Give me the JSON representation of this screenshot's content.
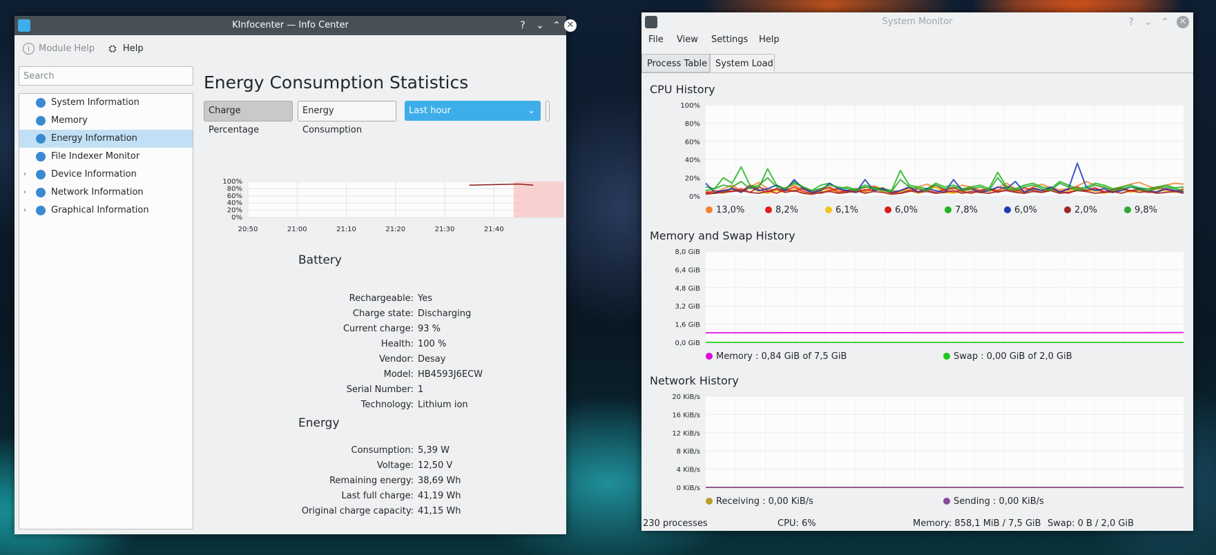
{
  "kinfo": {
    "window_title": "KInfocenter — Info Center",
    "toolbar": {
      "module_help": "Module Help",
      "help": "Help"
    },
    "search_placeholder": "Search",
    "tree": [
      {
        "label": "System Information",
        "expandable": false,
        "selected": false
      },
      {
        "label": "Memory",
        "expandable": false,
        "selected": false
      },
      {
        "label": "Energy Information",
        "expandable": false,
        "selected": true
      },
      {
        "label": "File Indexer Monitor",
        "expandable": false,
        "selected": false
      },
      {
        "label": "Device Information",
        "expandable": true,
        "selected": false
      },
      {
        "label": "Network Information",
        "expandable": true,
        "selected": false
      },
      {
        "label": "Graphical Information",
        "expandable": true,
        "selected": false
      }
    ],
    "title": "Energy Consumption Statistics",
    "buttons": {
      "charge": "Charge Percentage",
      "energy": "Energy Consumption"
    },
    "range_select": "Last hour",
    "chart_data": {
      "type": "line",
      "y_ticks": [
        "100%",
        "80%",
        "60%",
        "40%",
        "20%",
        "0%"
      ],
      "x_ticks": [
        "20:50",
        "21:00",
        "21:10",
        "21:20",
        "21:30",
        "21:40"
      ],
      "ylim": [
        0,
        100
      ],
      "series": [
        {
          "x": [
            "21:35",
            "21:45",
            "21:48"
          ],
          "values": [
            90,
            93,
            90
          ]
        }
      ],
      "colors": {
        "line": "#8b1a1a",
        "highlight": "#f9c6c6"
      }
    },
    "battery": {
      "heading": "Battery",
      "rows": [
        {
          "k": "Rechargeable:",
          "v": "Yes"
        },
        {
          "k": "Charge state:",
          "v": "Discharging"
        },
        {
          "k": "Current charge:",
          "v": "93 %"
        },
        {
          "k": "Health:",
          "v": "100 %"
        },
        {
          "k": "Vendor:",
          "v": "Desay"
        },
        {
          "k": "Model:",
          "v": "HB4593J6ECW"
        },
        {
          "k": "Serial Number:",
          "v": "1"
        },
        {
          "k": "Technology:",
          "v": "Lithium ion"
        }
      ]
    },
    "energy": {
      "heading": "Energy",
      "rows": [
        {
          "k": "Consumption:",
          "v": "5,39 W"
        },
        {
          "k": "Voltage:",
          "v": "12,50 V"
        },
        {
          "k": "Remaining energy:",
          "v": "38,69 Wh"
        },
        {
          "k": "Last full charge:",
          "v": "41,19 Wh"
        },
        {
          "k": "Original charge capacity:",
          "v": "41,15 Wh"
        }
      ]
    }
  },
  "sysmon": {
    "window_title": "System Monitor",
    "menu": [
      "File",
      "View",
      "Settings",
      "Help"
    ],
    "tabs": [
      "Process Table",
      "System Load"
    ],
    "cpu": {
      "title": "CPU History",
      "chart_data": {
        "type": "line",
        "y_ticks": [
          "100%",
          "80%",
          "60%",
          "40%",
          "20%",
          "0%"
        ],
        "ylim": [
          0,
          100
        ],
        "series": [
          {
            "name": "13,0%",
            "color": "#f0822f",
            "values": [
              5,
              4,
              8,
              12,
              6,
              10,
              15,
              8,
              6,
              9,
              12,
              7,
              5,
              8,
              10,
              6,
              4,
              7,
              9,
              11,
              8,
              6,
              5,
              7,
              10,
              13,
              9,
              6,
              8,
              12,
              10,
              7,
              5,
              9,
              14,
              8,
              6,
              10,
              13,
              9,
              7,
              8,
              11,
              16,
              12,
              9,
              7,
              10,
              13,
              15,
              11,
              8,
              12,
              14,
              13
            ]
          },
          {
            "name": "8,2%",
            "color": "#e41e1e",
            "values": [
              3,
              6,
              4,
              9,
              5,
              12,
              7,
              4,
              8,
              6,
              10,
              5,
              3,
              7,
              9,
              4,
              6,
              8,
              5,
              10,
              7,
              3,
              6,
              9,
              5,
              8,
              12,
              6,
              4,
              7,
              9,
              5,
              8,
              6,
              11,
              7,
              4,
              9,
              6,
              8,
              5,
              7,
              10,
              6,
              8,
              4,
              7,
              9,
              5,
              8,
              6,
              10,
              7,
              5,
              8
            ]
          },
          {
            "name": "6,1%",
            "color": "#f0c419",
            "values": [
              2,
              5,
              3,
              7,
              4,
              9,
              5,
              3,
              6,
              4,
              8,
              3,
              2,
              5,
              7,
              3,
              4,
              6,
              4,
              8,
              5,
              2,
              4,
              7,
              3,
              6,
              10,
              4,
              3,
              5,
              7,
              4,
              6,
              5,
              9,
              5,
              3,
              7,
              4,
              6,
              4,
              5,
              8,
              5,
              6,
              3,
              5,
              7,
              4,
              6,
              5,
              8,
              5,
              4,
              6
            ]
          },
          {
            "name": "6,0%",
            "color": "#d91c1c",
            "values": [
              4,
              3,
              6,
              5,
              8,
              4,
              10,
              6,
              3,
              7,
              5,
              9,
              4,
              3,
              6,
              8,
              5,
              4,
              7,
              6,
              9,
              4,
              3,
              5,
              8,
              6,
              4,
              7,
              9,
              5,
              3,
              6,
              8,
              4,
              7,
              5,
              9,
              6,
              4,
              8,
              5,
              3,
              7,
              6,
              9,
              5,
              4,
              8,
              6,
              7,
              4,
              5,
              8,
              6,
              5
            ]
          },
          {
            "name": "7,8%",
            "color": "#1eb41e",
            "values": [
              10,
              8,
              20,
              14,
              32,
              12,
              9,
              30,
              12,
              8,
              16,
              10,
              6,
              12,
              14,
              8,
              10,
              7,
              12,
              9,
              8,
              6,
              28,
              12,
              10,
              8,
              14,
              10,
              12,
              8,
              10,
              12,
              8,
              26,
              10,
              8,
              12,
              14,
              10,
              8,
              16,
              12,
              8,
              10,
              14,
              12,
              8,
              10,
              12,
              9,
              8,
              10,
              12,
              9,
              10
            ]
          },
          {
            "name": "6,0%",
            "color": "#1a3cb4",
            "values": [
              14,
              4,
              6,
              8,
              4,
              10,
              6,
              8,
              12,
              6,
              18,
              8,
              4,
              6,
              14,
              8,
              6,
              4,
              18,
              6,
              8,
              4,
              6,
              10,
              4,
              8,
              6,
              4,
              18,
              6,
              8,
              4,
              6,
              10,
              8,
              16,
              4,
              8,
              6,
              10,
              4,
              8,
              36,
              10,
              6,
              8,
              4,
              6,
              10,
              8,
              6,
              4,
              8,
              6,
              4
            ]
          },
          {
            "name": "2,0%",
            "color": "#a02828",
            "values": [
              2,
              3,
              4,
              5,
              6,
              4,
              3,
              5,
              8,
              4,
              6,
              3,
              2,
              4,
              5,
              3,
              4,
              6,
              3,
              5,
              4,
              2,
              3,
              6,
              4,
              5,
              3,
              4,
              6,
              3,
              5,
              4,
              3,
              5,
              6,
              4,
              3,
              5,
              4,
              6,
              3,
              4,
              6,
              5,
              3,
              4,
              5,
              3,
              6,
              4,
              5,
              3,
              4,
              5,
              3
            ]
          },
          {
            "name": "9,8%",
            "color": "#2ea82e",
            "values": [
              6,
              8,
              12,
              10,
              16,
              8,
              12,
              20,
              10,
              8,
              14,
              10,
              6,
              8,
              12,
              10,
              8,
              6,
              10,
              8,
              6,
              5,
              18,
              10,
              8,
              6,
              12,
              8,
              10,
              6,
              8,
              10,
              6,
              20,
              8,
              6,
              10,
              12,
              8,
              6,
              14,
              10,
              6,
              8,
              12,
              10,
              6,
              8,
              10,
              7,
              6,
              8,
              10,
              8,
              6
            ]
          }
        ]
      }
    },
    "memory": {
      "title": "Memory and Swap History",
      "chart_data": {
        "type": "line",
        "y_ticks": [
          "8,0 GiB",
          "6,4 GiB",
          "4,8 GiB",
          "3,2 GiB",
          "1,6 GiB",
          "0,0 GiB"
        ],
        "ylim": [
          0,
          8
        ],
        "series": [
          {
            "name": "Memory : 0,84 GiB of 7,5 GiB",
            "color": "#e000e0",
            "values": [
              0.84,
              0.86
            ]
          },
          {
            "name": "Swap : 0,00 GiB of 2,0 GiB",
            "color": "#1ec81e",
            "values": [
              0.0,
              0.0
            ]
          }
        ]
      }
    },
    "network": {
      "title": "Network History",
      "chart_data": {
        "type": "line",
        "y_ticks": [
          "20 KiB/s",
          "16 KiB/s",
          "12 KiB/s",
          "8 KiB/s",
          "4 KiB/s",
          "0 KiB/s"
        ],
        "ylim": [
          0,
          20
        ],
        "series": [
          {
            "name": "Receiving : 0,00 KiB/s",
            "color": "#b8a02a",
            "values": [
              0,
              0
            ]
          },
          {
            "name": "Sending : 0,00 KiB/s",
            "color": "#8a4a9a",
            "values": [
              0,
              0
            ]
          }
        ]
      }
    },
    "status": {
      "processes": "230 processes",
      "cpu": "CPU: 6%",
      "memory": "Memory: 858,1 MiB / 7,5 GiB",
      "swap": "Swap: 0 B / 2,0 GiB"
    }
  }
}
